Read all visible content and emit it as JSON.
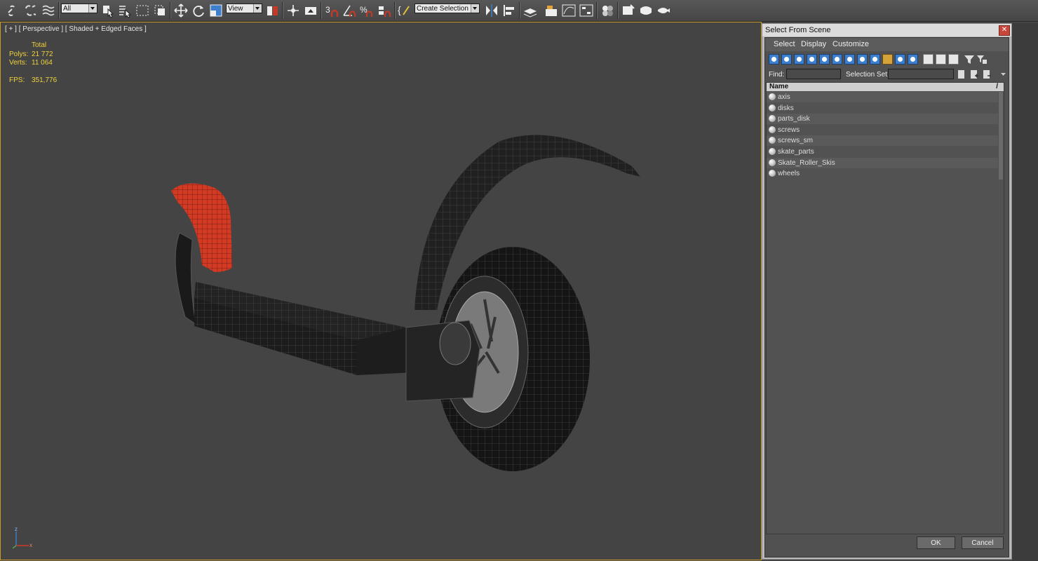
{
  "toolbar": {
    "filter_combo": "All",
    "refcoord_combo": "View",
    "selection_set_combo": "Create Selection Se",
    "icons": [
      "link-icon",
      "unlink-icon",
      "bind-spacewarp-icon",
      "select-object-icon",
      "select-by-name-icon",
      "rect-selection-icon",
      "window-crossing-icon",
      "move-icon",
      "rotate-icon",
      "scale-icon",
      "use-pivot-icon",
      "select-manipulate-icon",
      "keyboard-shortcut-icon",
      "snaps-toggle-icon",
      "angle-snap-icon",
      "percent-snap-icon",
      "spinner-snap-icon",
      "edit-named-selection-icon",
      "mirror-icon",
      "align-icon",
      "layer-manager-icon",
      "graphite-ribbon-icon",
      "curve-editor-icon",
      "schematic-view-icon",
      "material-editor-icon",
      "render-setup-icon",
      "rendered-frame-icon",
      "render-icon"
    ]
  },
  "viewport": {
    "label": "[ + ] [ Perspective ] [ Shaded + Edged Faces ]",
    "stats": {
      "total_label": "Total",
      "polys_label": "Polys:",
      "polys_value": "21 772",
      "verts_label": "Verts:",
      "verts_value": "11 064",
      "fps_label": "FPS:",
      "fps_value": "351,776"
    },
    "axis": {
      "z": "z",
      "x": "x"
    }
  },
  "dialog": {
    "title": "Select From Scene",
    "close": "✕",
    "menus": [
      "Select",
      "Display",
      "Customize"
    ],
    "find_label": "Find:",
    "find_value": "",
    "selection_set_label": "Selection Set:",
    "selection_set_value": "",
    "column_header": "Name",
    "sort_glyph": "/",
    "objects": [
      "axis",
      "disks",
      "parts_disk",
      "screws",
      "screws_sm",
      "skate_parts",
      "Skate_Roller_Skis",
      "wheels"
    ],
    "ok_label": "OK",
    "cancel_label": "Cancel"
  },
  "colors": {
    "viewport_bg": "#444444",
    "stats_yellow": "#f0d23a",
    "viewport_border": "#c89a2a",
    "selected_red": "#d23a24",
    "dialog_icon_blue": "#3d7fcf"
  }
}
